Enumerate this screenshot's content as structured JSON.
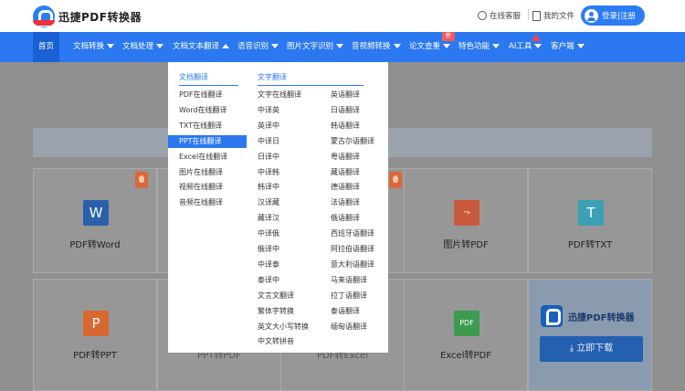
{
  "header": {
    "logo_text": "迅捷PDF转换器",
    "support_label": "在线客服",
    "files_label": "我的文件",
    "login_label": "登录|注册"
  },
  "nav": {
    "items": [
      {
        "label": "首页",
        "active": true
      },
      {
        "label": "文档转换"
      },
      {
        "label": "文档处理"
      },
      {
        "label": "文档文本翻译",
        "open": true
      },
      {
        "label": "语音识别"
      },
      {
        "label": "图片文字识别"
      },
      {
        "label": "音视频转换"
      },
      {
        "label": "论文查重",
        "badge": "新"
      },
      {
        "label": "特色功能"
      },
      {
        "label": "AI工具"
      },
      {
        "label": "客户端"
      }
    ]
  },
  "dropdown": {
    "doc_heading": "文档翻译",
    "text_heading": "文字翻译",
    "doc_items": [
      "PDF在线翻译",
      "Word在线翻译",
      "TXT在线翻译",
      "PPT在线翻译",
      "Excel在线翻译",
      "图片在线翻译",
      "视频在线翻译",
      "音频在线翻译"
    ],
    "doc_selected": "PPT在线翻译",
    "text_col1": [
      "文字在线翻译",
      "中译英",
      "英译中",
      "中译日",
      "日译中",
      "中译韩",
      "韩译中",
      "汉译藏",
      "藏译汉",
      "中译俄",
      "俄译中",
      "中译泰",
      "泰译中",
      "文言文翻译",
      "繁体字转换",
      "英文大小写转换",
      "中文转拼音"
    ],
    "text_col2": [
      "英语翻译",
      "日语翻译",
      "韩语翻译",
      "蒙古尔语翻译",
      "粤语翻译",
      "藏语翻译",
      "德语翻译",
      "法语翻译",
      "俄语翻译",
      "西班牙语翻译",
      "阿拉伯语翻译",
      "意大利语翻译",
      "马来语翻译",
      "拉丁语翻译",
      "泰语翻译",
      "缅甸语翻译"
    ]
  },
  "cards": {
    "row1": [
      {
        "label": "PDF转Word",
        "icon": "W",
        "color": "#2a5faa"
      },
      {
        "label": "图片转PDF",
        "icon": "pdf",
        "color": "#c95a3b"
      },
      {
        "label": "PDF转TXT",
        "icon": "T",
        "color": "#3ba0b5"
      }
    ],
    "row2": [
      {
        "label": "PDF转PPT",
        "icon": "P",
        "color": "#d9682f"
      },
      {
        "label": "PPT转PDF"
      },
      {
        "label": "PDF转Excel"
      },
      {
        "label": "Excel转PDF",
        "icon": "PDF",
        "color": "#3d9a4f"
      }
    ]
  },
  "promo": {
    "name": "迅捷PDF转换器",
    "download_label": "立即下载"
  }
}
